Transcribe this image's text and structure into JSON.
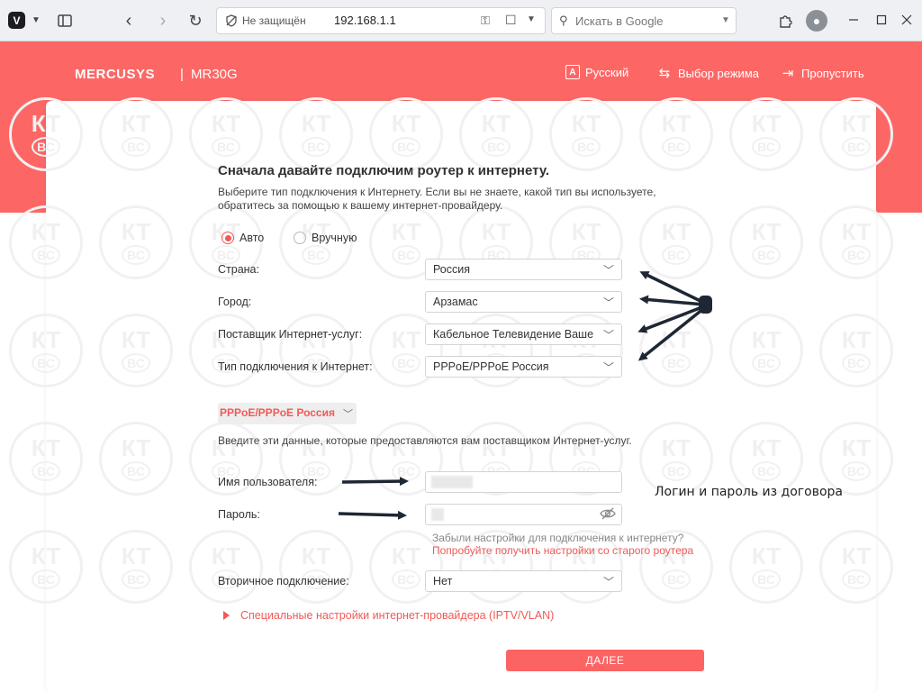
{
  "browser": {
    "not_secure": "Не защищён",
    "url": "192.168.1.1",
    "search_placeholder": "Искать в Google",
    "icons": [
      "vivaldi-icon",
      "panel-icon",
      "back-icon",
      "forward-icon",
      "reload-icon",
      "shield-icon",
      "key-icon",
      "bookmark-icon",
      "search-icon",
      "extensions-icon",
      "profile-icon",
      "minimize-icon",
      "maximize-icon",
      "close-icon"
    ]
  },
  "header": {
    "brand": "MERCUSYS",
    "separator": "|",
    "model": "MR30G",
    "language": "Русский",
    "mode_select": "Выбор режима",
    "skip": "Пропустить",
    "band_color": "#fc6765"
  },
  "main": {
    "title": "Сначала давайте подключим роутер к интернету.",
    "description": "Выберите тип подключения к Интернету. Если вы не знаете, какой тип вы используете, обратитесь за помощью к вашему интернет-провайдеру.",
    "mode_auto": "Авто",
    "mode_manual": "Вручную",
    "selected_mode": "Авто",
    "country_label": "Страна:",
    "country_value": "Россия",
    "city_label": "Город:",
    "city_value": "Арзамас",
    "isp_label": "Поставщик Интернет-услуг:",
    "isp_value": "Кабельное Телевидение Ваше",
    "conn_type_label": "Тип подключения к Интернет:",
    "conn_type_value": "PPPoE/PPPoE Россия",
    "badge": "PPPoE/PPPoE Россия",
    "enter_text": "Введите эти данные, которые предоставляются вам поставщиком Интернет-услуг.",
    "username_label": "Имя пользователя:",
    "password_label": "Пароль:",
    "forgot_text": "Забыли настройки для подключения к интернету?",
    "try_link": "Попробуйте получить настройки со старого роутера",
    "secondary_label": "Вторичное подключение:",
    "secondary_value": "Нет",
    "special_link": "Специальные настройки интернет-провайдера (IPTV/VLAN)",
    "next_button": "ДАЛЕЕ",
    "accent_color": "#f05a57"
  },
  "annotation": {
    "caption": "Логин и пароль из договора"
  },
  "watermark": {
    "top": "КТ",
    "bottom": "ВС"
  }
}
